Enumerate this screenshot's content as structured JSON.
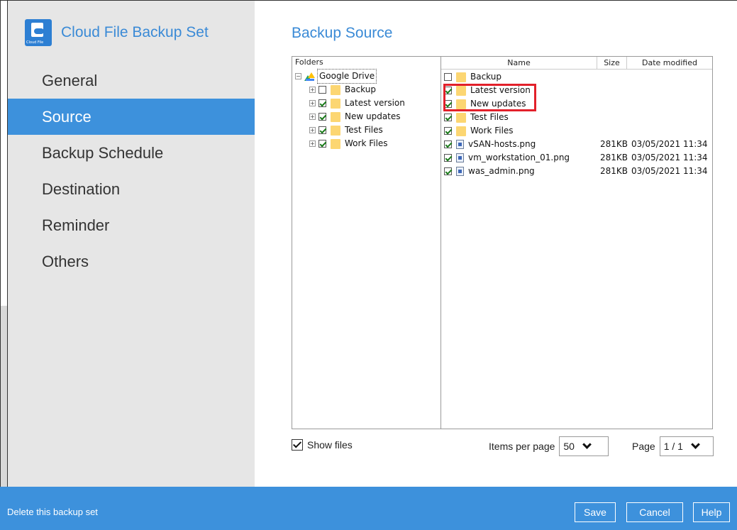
{
  "brand": {
    "title": "Cloud File Backup Set",
    "logo_text": "Cloud File"
  },
  "sidebar": {
    "items": [
      {
        "label": "General"
      },
      {
        "label": "Source"
      },
      {
        "label": "Backup Schedule"
      },
      {
        "label": "Destination"
      },
      {
        "label": "Reminder"
      },
      {
        "label": "Others"
      }
    ],
    "active": "Source"
  },
  "main": {
    "title": "Backup Source",
    "folders_header": "Folders",
    "tree": {
      "root": "Google Drive",
      "children": [
        {
          "label": "Backup",
          "checked": false
        },
        {
          "label": "Latest version",
          "checked": true
        },
        {
          "label": "New updates",
          "checked": true
        },
        {
          "label": "Test Files",
          "checked": true
        },
        {
          "label": "Work Files",
          "checked": true
        }
      ]
    },
    "columns": {
      "name": "Name",
      "size": "Size",
      "date": "Date modified"
    },
    "files": [
      {
        "name": "Backup",
        "type": "folder",
        "checked": false,
        "size": "",
        "date": ""
      },
      {
        "name": "Latest version",
        "type": "folder",
        "checked": true,
        "size": "",
        "date": ""
      },
      {
        "name": "New updates",
        "type": "folder",
        "checked": true,
        "size": "",
        "date": ""
      },
      {
        "name": "Test Files",
        "type": "folder",
        "checked": true,
        "size": "",
        "date": ""
      },
      {
        "name": "Work Files",
        "type": "folder",
        "checked": true,
        "size": "",
        "date": ""
      },
      {
        "name": "vSAN-hosts.png",
        "type": "file",
        "checked": true,
        "size": "281KB",
        "date": "03/05/2021 11:34"
      },
      {
        "name": "vm_workstation_01.png",
        "type": "file",
        "checked": true,
        "size": "281KB",
        "date": "03/05/2021 11:34"
      },
      {
        "name": "was_admin.png",
        "type": "file",
        "checked": true,
        "size": "281KB",
        "date": "03/05/2021 11:34"
      }
    ],
    "show_files_label": "Show files",
    "show_files_checked": true,
    "items_per_page_label": "Items per page",
    "items_per_page_value": "50",
    "page_label": "Page",
    "page_value": "1 / 1"
  },
  "footer": {
    "delete_label": "Delete this backup set",
    "save_label": "Save",
    "cancel_label": "Cancel",
    "help_label": "Help"
  },
  "colors": {
    "accent": "#3d91dc",
    "highlight": "#e2202a",
    "folder": "#fcd672"
  }
}
